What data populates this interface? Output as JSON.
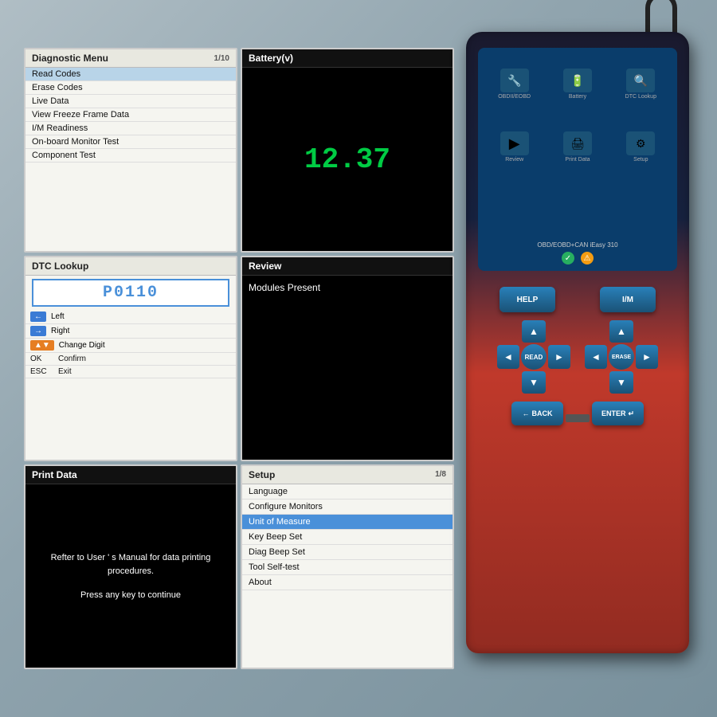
{
  "screens": {
    "diagnostic_menu": {
      "title": "Diagnostic Menu",
      "page": "1/10",
      "items": [
        "Read Codes",
        "Erase Codes",
        "Live Data",
        "View Freeze Frame Data",
        "I/M Readiness",
        "On-board Monitor Test",
        "Component Test"
      ]
    },
    "battery": {
      "title": "Battery(v)",
      "value": "12.37"
    },
    "dtc_lookup": {
      "title": "DTC Lookup",
      "code": "P0110",
      "rows": [
        {
          "key": "←",
          "label": "Left"
        },
        {
          "key": "→",
          "label": "Right"
        },
        {
          "key": "▲▼",
          "label": "Change Digit"
        },
        {
          "key": "OK",
          "label": "Confirm"
        },
        {
          "key": "ESC",
          "label": "Exit"
        }
      ]
    },
    "review": {
      "title": "Review",
      "text": "Modules Present"
    },
    "print_data": {
      "title": "Print Data",
      "body_text": "Refter to User ' s Manual for data printing procedures.",
      "continue_text": "Press any key to continue"
    },
    "setup": {
      "title": "Setup",
      "page": "1/8",
      "items": [
        "Language",
        "Configure Monitors",
        "Unit of Measure",
        "Key Beep Set",
        "Diag Beep Set",
        "Tool Self-test",
        "About"
      ]
    }
  },
  "device": {
    "brand": "OBD/EOBD+CAN iEasy 310",
    "icons": [
      {
        "label": "OBDII/EOBD",
        "symbol": "🔧"
      },
      {
        "label": "Battery",
        "symbol": "🔋"
      },
      {
        "label": "DTC Lookup",
        "symbol": "🔍"
      },
      {
        "label": "Review",
        "symbol": "▶"
      },
      {
        "label": "Print Data",
        "symbol": "🖨"
      },
      {
        "label": "Setup",
        "symbol": "⚙"
      }
    ],
    "buttons": {
      "help": "HELP",
      "im": "I/M",
      "read": "READ",
      "erase": "ERASE",
      "back": "BACK",
      "enter": "ENTER"
    }
  }
}
